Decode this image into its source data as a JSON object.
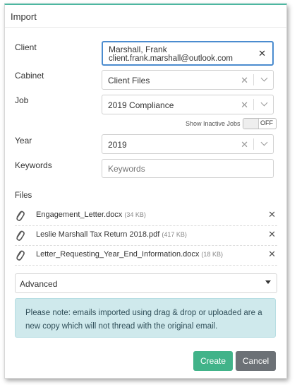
{
  "dialog": {
    "title": "Import"
  },
  "client": {
    "label": "Client",
    "name": "Marshall, Frank",
    "email": "client.frank.marshall@outlook.com"
  },
  "cabinet": {
    "label": "Cabinet",
    "value": "Client Files"
  },
  "job": {
    "label": "Job",
    "value": "2019 Compliance"
  },
  "inactive_jobs": {
    "label": "Show Inactive Jobs",
    "state": "OFF"
  },
  "year": {
    "label": "Year",
    "value": "2019"
  },
  "keywords": {
    "label": "Keywords",
    "placeholder": "Keywords"
  },
  "files": {
    "label": "Files",
    "items": [
      {
        "name": "Engagement_Letter.docx",
        "size": "(34 KB)"
      },
      {
        "name": "Leslie Marshall Tax Return 2018.pdf",
        "size": "(417 KB)"
      },
      {
        "name": "Letter_Requesting_Year_End_Information.docx",
        "size": "(18 KB)"
      }
    ]
  },
  "advanced": {
    "label": "Advanced"
  },
  "note": {
    "text": "Please note: emails imported using drag & drop or uploaded are a new copy which will not thread with the original email."
  },
  "buttons": {
    "create": "Create",
    "cancel": "Cancel"
  },
  "colors": {
    "accent": "#41b389",
    "focus": "#4b8ccf",
    "note_bg": "#cfe9ec",
    "cancel": "#6c7176"
  },
  "icons": {
    "remove": "close-icon",
    "clear": "clear-icon",
    "dropdown": "chevron-down-icon",
    "attachment": "paperclip-icon"
  }
}
